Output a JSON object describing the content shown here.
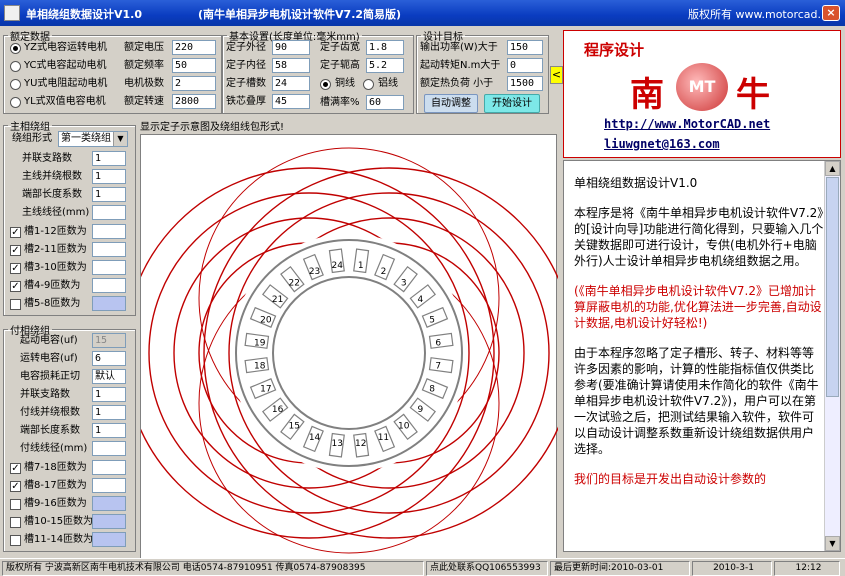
{
  "titlebar": {
    "title": "单相绕组数据设计V1.0",
    "subtitle": "(南牛单相异步电机设计软件V7.2简易版)",
    "copyright": "版权所有 www.motorcad.net",
    "close": "×"
  },
  "rated": {
    "legend": "额定数据",
    "modes": [
      "YZ式电容运转电机",
      "YC式电容起动电机",
      "YU式电阻起动电机",
      "YL式双值电容电机"
    ],
    "selected_mode": 0,
    "fields": [
      {
        "label": "额定电压",
        "value": "220"
      },
      {
        "label": "额定频率",
        "value": "50"
      },
      {
        "label": "电机极数",
        "value": "2"
      },
      {
        "label": "额定转速",
        "value": "2800"
      }
    ]
  },
  "basic": {
    "legend": "基本设置(长度单位:毫米mm)",
    "left": [
      {
        "label": "定子外径",
        "value": "90"
      },
      {
        "label": "定子内径",
        "value": "58"
      },
      {
        "label": "定子槽数",
        "value": "24"
      },
      {
        "label": "铁芯叠厚",
        "value": "45"
      }
    ],
    "right": [
      {
        "label": "定子齿宽",
        "value": "1.8"
      },
      {
        "label": "定子轭高",
        "value": "5.2"
      }
    ],
    "wire_copper": "铜线",
    "wire_alu": "铝线",
    "fill_label": "槽满率%",
    "fill_value": "60"
  },
  "target": {
    "legend": "设计目标",
    "fields": [
      {
        "label": "输出功率(W)大于",
        "value": "150"
      },
      {
        "label": "起动转矩N.m大于",
        "value": "0"
      },
      {
        "label": "额定热负荷 小于",
        "value": "1500"
      }
    ],
    "btn_auto": "自动调整",
    "btn_start": "开始设计"
  },
  "toggle": "<",
  "main_winding": {
    "legend": "主相绕组",
    "form_label": "绕组形式",
    "form_value": "第一类绕组",
    "fields": [
      {
        "label": "并联支路数",
        "value": "1"
      },
      {
        "label": "主线并绕根数",
        "value": "1"
      },
      {
        "label": "端部长度系数",
        "value": "1"
      },
      {
        "label": "主线线径(mm)",
        "value": ""
      }
    ],
    "slots": [
      {
        "label": "槽1-12匝数为",
        "checked": true
      },
      {
        "label": "槽2-11匝数为",
        "checked": true
      },
      {
        "label": "槽3-10匝数为",
        "checked": true
      },
      {
        "label": "槽4-9匝数为",
        "checked": true
      },
      {
        "label": "槽5-8匝数为",
        "checked": false
      }
    ]
  },
  "aux_winding": {
    "legend": "付相绕组",
    "fields": [
      {
        "label": "起动电容(uf)",
        "value": "15"
      },
      {
        "label": "运转电容(uf)",
        "value": "6"
      },
      {
        "label": "电容损耗正切",
        "value": "默认"
      },
      {
        "label": "并联支路数",
        "value": "1"
      },
      {
        "label": "付线并绕根数",
        "value": "1"
      },
      {
        "label": "端部长度系数",
        "value": "1"
      },
      {
        "label": "付线线径(mm)",
        "value": ""
      }
    ],
    "slots": [
      {
        "label": "槽7-18匝数为",
        "checked": true
      },
      {
        "label": "槽8-17匝数为",
        "checked": true
      },
      {
        "label": "槽9-16匝数为",
        "checked": false
      },
      {
        "label": "槽10-15匝数为",
        "checked": false
      },
      {
        "label": "槽11-14匝数为",
        "checked": false
      }
    ]
  },
  "canvas_caption": "显示定子示意图及绕组线包形式!",
  "slot_count": 24,
  "logo": {
    "heading": "程序设计",
    "brand_left": "南",
    "brand_mark": "MT",
    "brand_right": "牛",
    "url": "http://www.MotorCAD.net",
    "email": "liuwgnet@163.com"
  },
  "info": {
    "p1": "单相绕组数据设计V1.0",
    "p2": "本程序是将《南牛单相异步电机设计软件V7.2》的[设计向导]功能进行简化得到，只要输入几个关键数据即可进行设计，专供(电机外行+电脑外行)人士设计单相异步电机绕组数据之用。",
    "p3": "(《南牛单相异步电机设计软件V7.2》已增加计算屏蔽电机的功能,优化算法进一步完善,自动设计数据,电机设计好轻松!)",
    "p4": "由于本程序忽略了定子槽形、转子、材料等等许多因素的影响，计算的性能指标值仅供类比参考(要准确计算请使用未作简化的软件《南牛单相异步电机设计软件V7.2》)，用户可以在第一次试验之后，把测试结果输入软件，软件可以自动设计调整系数重新设计绕组数据供用户选择。",
    "p5": "我们的目标是开发出自动设计参数的"
  },
  "statusbar": {
    "company": "版权所有 宁波高新区南牛电机技术有限公司 电话0574-87910951 传真0574-87908395",
    "qq": "点此处联系QQ106553993",
    "updated": "最后更新时间:2010-03-01",
    "date": "2010-3-1",
    "time": "12:12"
  },
  "colors": {
    "titlebar": "#0a3cc0",
    "coil": "#c00000",
    "stator": "#808080",
    "brand_red": "#cc0000"
  }
}
